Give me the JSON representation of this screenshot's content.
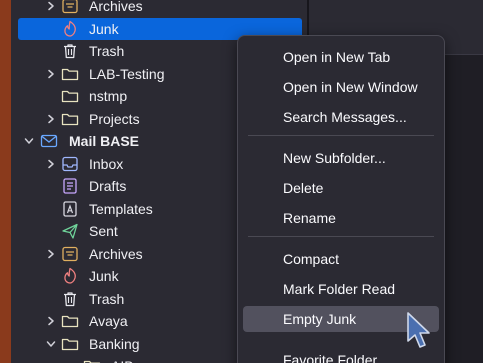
{
  "folders": [
    {
      "label": "Archives",
      "chevron": "right",
      "icon": "archive-icon",
      "bold": false,
      "selected": false
    },
    {
      "label": "Junk",
      "chevron": "",
      "icon": "junk-icon",
      "bold": false,
      "selected": true
    },
    {
      "label": "Trash",
      "chevron": "",
      "icon": "trash-icon",
      "bold": false,
      "selected": false
    },
    {
      "label": "LAB-Testing",
      "chevron": "right",
      "icon": "folder-icon",
      "bold": false,
      "selected": false
    },
    {
      "label": "nstmp",
      "chevron": "",
      "icon": "folder-icon",
      "bold": false,
      "selected": false
    },
    {
      "label": "Projects",
      "chevron": "right",
      "icon": "folder-icon",
      "bold": false,
      "selected": false
    },
    {
      "label": "Mail BASE",
      "chevron": "down",
      "icon": "mail-account-icon",
      "bold": true,
      "selected": false
    },
    {
      "label": "Inbox",
      "chevron": "right",
      "icon": "inbox-icon",
      "bold": false,
      "selected": false
    },
    {
      "label": "Drafts",
      "chevron": "",
      "icon": "drafts-icon",
      "bold": false,
      "selected": false
    },
    {
      "label": "Templates",
      "chevron": "",
      "icon": "templates-icon",
      "bold": false,
      "selected": false
    },
    {
      "label": "Sent",
      "chevron": "",
      "icon": "sent-icon",
      "bold": false,
      "selected": false
    },
    {
      "label": "Archives",
      "chevron": "right",
      "icon": "archive-icon",
      "bold": false,
      "selected": false
    },
    {
      "label": "Junk",
      "chevron": "",
      "icon": "junk-icon",
      "bold": false,
      "selected": false
    },
    {
      "label": "Trash",
      "chevron": "",
      "icon": "trash-icon",
      "bold": false,
      "selected": false
    },
    {
      "label": "Avaya",
      "chevron": "right",
      "icon": "folder-icon",
      "bold": false,
      "selected": false
    },
    {
      "label": "Banking",
      "chevron": "down",
      "icon": "folder-icon",
      "bold": false,
      "selected": false
    },
    {
      "label": "AIB",
      "chevron": "",
      "icon": "folder-icon",
      "bold": false,
      "selected": false
    }
  ],
  "context_menu": {
    "items": [
      {
        "label": "Open in New Tab",
        "hover": false
      },
      {
        "label": "Open in New Window",
        "hover": false
      },
      {
        "label": "Search Messages...",
        "hover": false
      },
      {
        "label": "New Subfolder...",
        "hover": false
      },
      {
        "label": "Delete",
        "hover": false
      },
      {
        "label": "Rename",
        "hover": false
      },
      {
        "label": "Compact",
        "hover": false
      },
      {
        "label": "Mark Folder Read",
        "hover": false
      },
      {
        "label": "Empty Junk",
        "hover": true
      },
      {
        "label": "Favorite Folder",
        "hover": false
      }
    ]
  },
  "colors": {
    "selected_row": "#0a66dc",
    "menu_background": "#2b2a33",
    "menu_hover": "#52515e",
    "accent_strip": "#8a3a1c"
  }
}
